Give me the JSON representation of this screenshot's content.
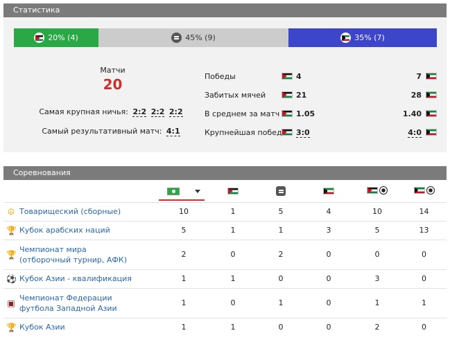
{
  "stats": {
    "header": "Статистика",
    "bar": {
      "home": "20% (4)",
      "draw": "45% (9)",
      "away": "35% (7)"
    },
    "matches_label": "Матчи",
    "matches_value": "20",
    "biggest_draw_label": "Самая крупная ничья:",
    "biggest_draw_values": [
      "2:2",
      "2:2",
      "2:2"
    ],
    "most_productive_label": "Самый результативный матч:",
    "most_productive_value": "4:1",
    "rows": [
      {
        "label": "Победы",
        "home": "4",
        "away": "7"
      },
      {
        "label": "Забитых мячей",
        "home": "21",
        "away": "28"
      },
      {
        "label": "В среднем за матч",
        "home": "1.05",
        "away": "1.40"
      },
      {
        "label": "Крупнейшая победа",
        "home": "3:0",
        "away": "4:0"
      }
    ]
  },
  "competitions": {
    "header": "Соревнования",
    "rows": [
      {
        "name": "Товарищеский (сборные)",
        "icon": "peace-icon",
        "all": "10",
        "home": "1",
        "draw": "5",
        "away": "4",
        "home_goals": "10",
        "away_goals": "14"
      },
      {
        "name": "Кубок арабских наций",
        "icon": "trophy-silver-icon",
        "all": "5",
        "home": "1",
        "draw": "1",
        "away": "3",
        "home_goals": "5",
        "away_goals": "13"
      },
      {
        "name": "Чемпионат мира (отборочный турнир, АФК)",
        "icon": "world-cup-icon",
        "all": "2",
        "home": "0",
        "draw": "2",
        "away": "0",
        "home_goals": "0",
        "away_goals": "0"
      },
      {
        "name": "Кубок Азии - квалификация",
        "icon": "asian-cup-qual-icon",
        "all": "1",
        "home": "1",
        "draw": "0",
        "away": "0",
        "home_goals": "3",
        "away_goals": "0"
      },
      {
        "name": "Чемпионат Федерации футбола Западной Азии",
        "icon": "waff-icon",
        "all": "1",
        "home": "0",
        "draw": "1",
        "away": "0",
        "home_goals": "1",
        "away_goals": "1"
      },
      {
        "name": "Кубок Азии",
        "icon": "asian-cup-icon",
        "all": "1",
        "home": "1",
        "draw": "0",
        "away": "0",
        "home_goals": "2",
        "away_goals": "0"
      }
    ]
  }
}
